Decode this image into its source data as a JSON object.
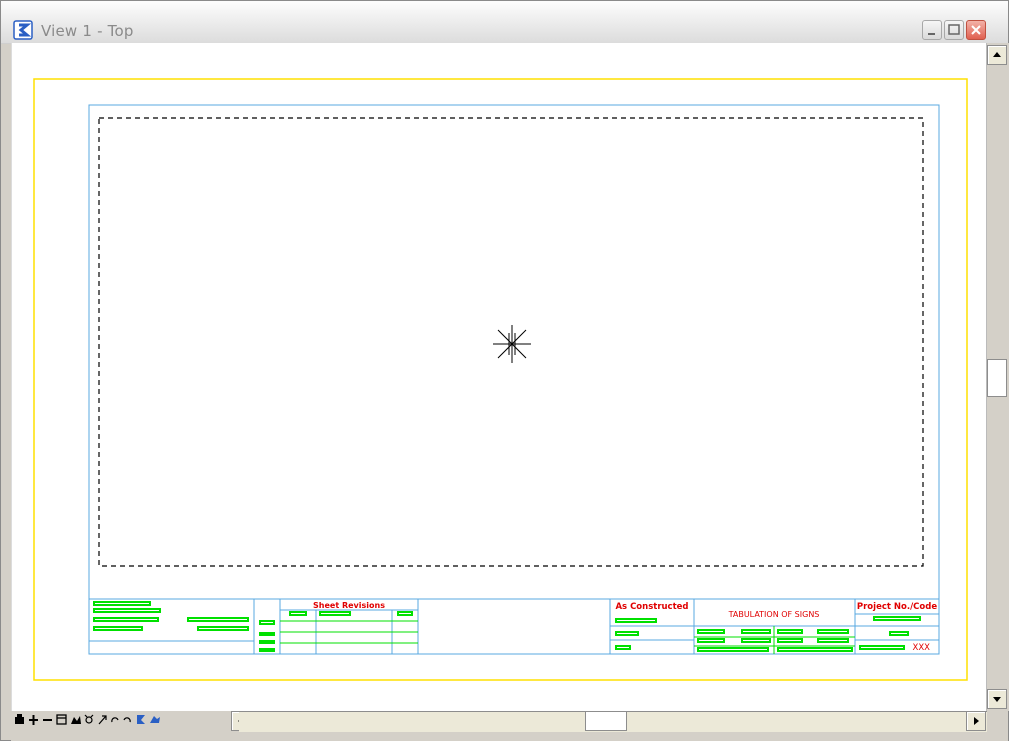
{
  "window": {
    "title": "View 1 - Top",
    "accent_color": "#2a5fc4"
  },
  "drawing": {
    "sheet_revisions_label": "Sheet Revisions",
    "as_constructed_label": "As Constructed",
    "tabulation_label": "TABULATION OF SIGNS",
    "project_label": "Project No./Code",
    "xxx_label": "XXX",
    "colors": {
      "sheet_border": "#ffe000",
      "frame": "#58a8e0",
      "cells": "#00e000",
      "titles": "#e00000"
    }
  },
  "toolbar": {
    "icons": [
      "print-icon",
      "zoom-in-icon",
      "zoom-out-icon",
      "window-area-icon",
      "fit-view-icon",
      "rotate-view-icon",
      "pan-icon",
      "undo-view-icon",
      "redo-view-icon",
      "view-attributes-icon",
      "camera-icon"
    ]
  }
}
